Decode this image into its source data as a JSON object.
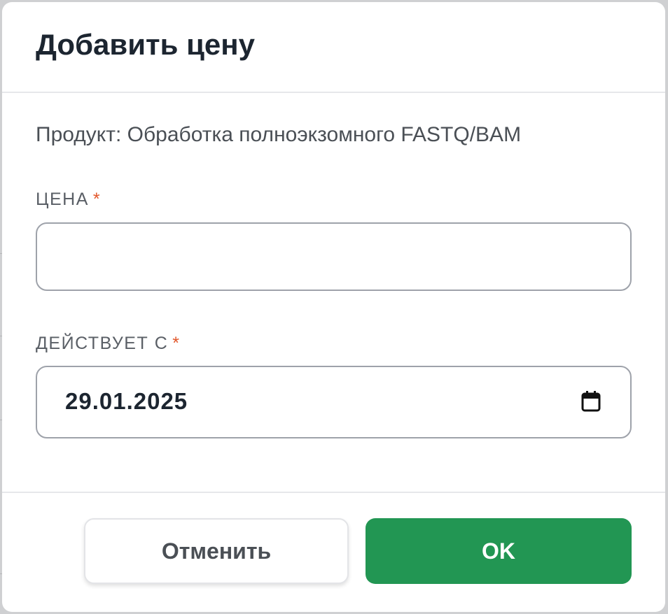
{
  "dialog": {
    "title": "Добавить цену",
    "product_line": "Продукт: Обработка полноэкзомного FASTQ/BAM"
  },
  "price_field": {
    "label": "ЦЕНА",
    "required_marker": "*",
    "value": "",
    "placeholder": ""
  },
  "effective_from_field": {
    "label": "ДЕЙСТВУЕТ С",
    "required_marker": "*",
    "value": "29.01.2025",
    "icon": "calendar-icon"
  },
  "footer": {
    "cancel_label": "Отменить",
    "ok_label": "OK"
  },
  "colors": {
    "accent_green": "#229653",
    "required_orange": "#e2572b",
    "title_text": "#1c2530"
  }
}
